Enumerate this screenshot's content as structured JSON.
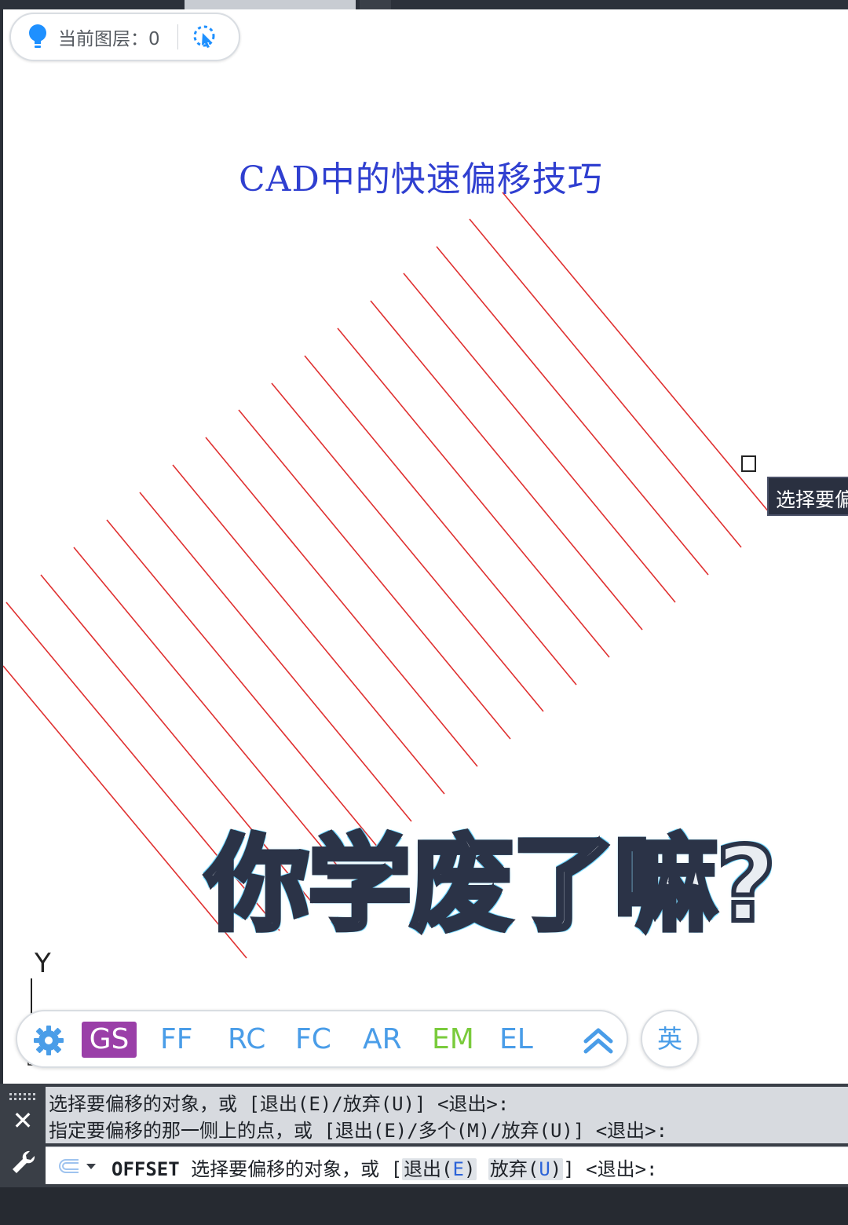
{
  "layer": {
    "label": "当前图层：0"
  },
  "drawing": {
    "title": "CAD中的快速偏移技巧",
    "line_color": "#e03030",
    "title_color": "#2f3fd0"
  },
  "tooltip": {
    "text": "选择要偏"
  },
  "overlay": {
    "text": "你学废了嘛?"
  },
  "ucs": {
    "y_label": "Y"
  },
  "shortcuts": {
    "items": [
      {
        "label": "GS",
        "color": "#9a3fa8"
      },
      {
        "label": "FF",
        "color": "#4a9de8"
      },
      {
        "label": "RC",
        "color": "#4a9de8"
      },
      {
        "label": "FC",
        "color": "#4a9de8"
      },
      {
        "label": "AR",
        "color": "#4a9de8"
      },
      {
        "label": "EM",
        "color": "#7acb3c"
      },
      {
        "label": "EL",
        "color": "#4a9de8"
      }
    ],
    "ime_label": "英"
  },
  "command": {
    "history": [
      "选择要偏移的对象，或 [退出(E)/放弃(U)] <退出>:",
      "指定要偏移的那一侧上的点，或 [退出(E)/多个(M)/放弃(U)] <退出>:"
    ],
    "current": {
      "command": "OFFSET",
      "prompt": "选择要偏移的对象，或 [",
      "opt_exit": "退出(",
      "opt_exit_key": "E",
      "opt_undo": "放弃(",
      "opt_undo_key": "U",
      "tail": "] <退出>:"
    }
  }
}
